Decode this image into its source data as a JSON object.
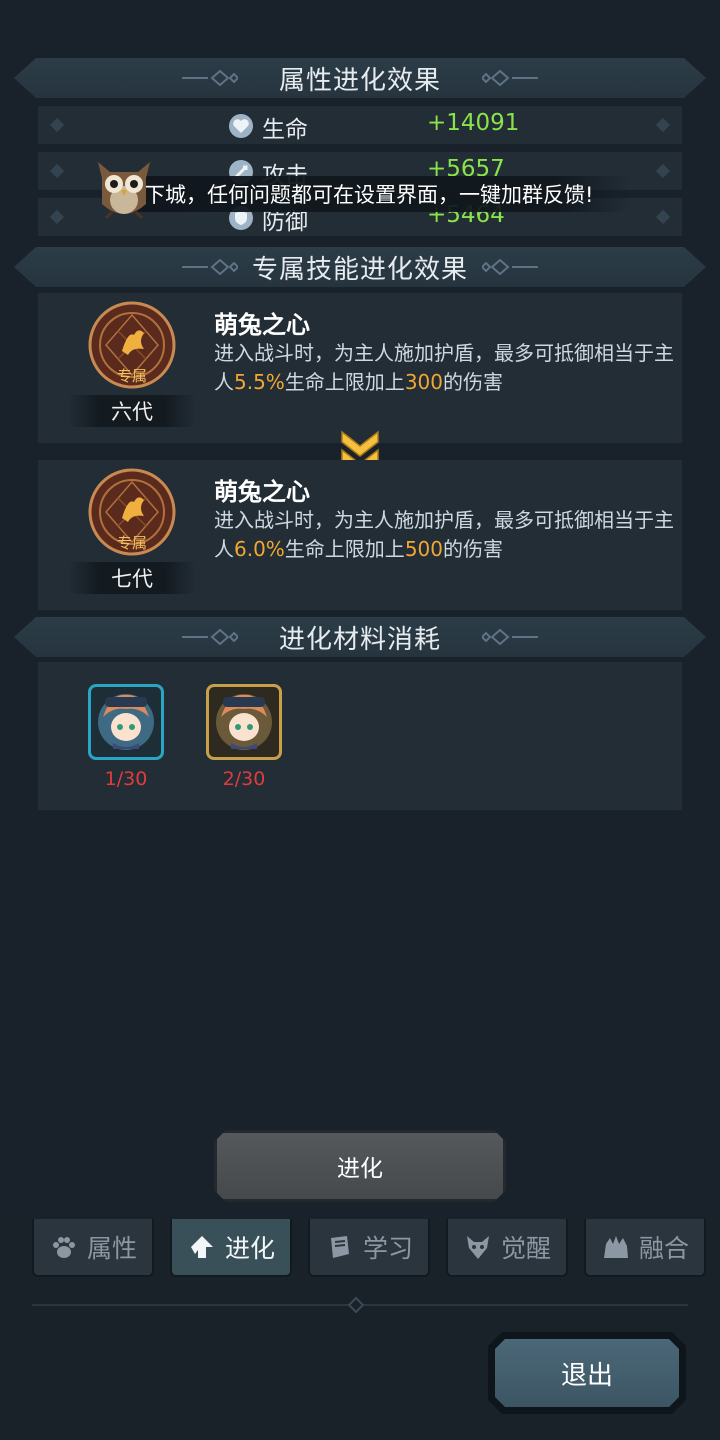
{
  "sections": {
    "attr_title": "属性进化效果",
    "skill_title": "专属技能进化效果",
    "material_title": "进化材料消耗"
  },
  "stats": [
    {
      "name": "生命",
      "value": "+14091",
      "icon": "heart-icon"
    },
    {
      "name": "攻击",
      "value": "+5657",
      "icon": "attack-icon"
    },
    {
      "name": "防御",
      "value": "+5464",
      "icon": "shield-icon"
    }
  ],
  "toast": {
    "text": "下城，任何问题都可在设置界面，一键加群反馈!"
  },
  "skills": [
    {
      "badge": "专属",
      "generation": "六代",
      "name": "萌兔之心",
      "desc_1": "进入战斗时，为主人施加护盾，最多可抵御相当于主人",
      "pct": "5.5%",
      "desc_2": "生命上限加上",
      "flat": "300",
      "desc_3": "的伤害"
    },
    {
      "badge": "专属",
      "generation": "七代",
      "name": "萌兔之心",
      "desc_1": "进入战斗时，为主人施加护盾，最多可抵御相当于主人",
      "pct": "6.0%",
      "desc_2": "生命上限加上",
      "flat": "500",
      "desc_3": "的伤害"
    }
  ],
  "materials": [
    {
      "count": "1/30",
      "frame": "#2aa6c4"
    },
    {
      "count": "2/30",
      "frame": "#c8a04a"
    }
  ],
  "evolve_button": "进化",
  "tabs": [
    {
      "label": "属性",
      "icon": "paw-icon",
      "active": false
    },
    {
      "label": "进化",
      "icon": "arrow-up-icon",
      "active": true
    },
    {
      "label": "学习",
      "icon": "book-icon",
      "active": false
    },
    {
      "label": "觉醒",
      "icon": "wolf-icon",
      "active": false
    },
    {
      "label": "融合",
      "icon": "beast-icon",
      "active": false
    }
  ],
  "exit_button": "退出",
  "colors": {
    "positive": "#8be34a",
    "highlight": "#f3a632",
    "insufficient": "#e03c3c"
  }
}
